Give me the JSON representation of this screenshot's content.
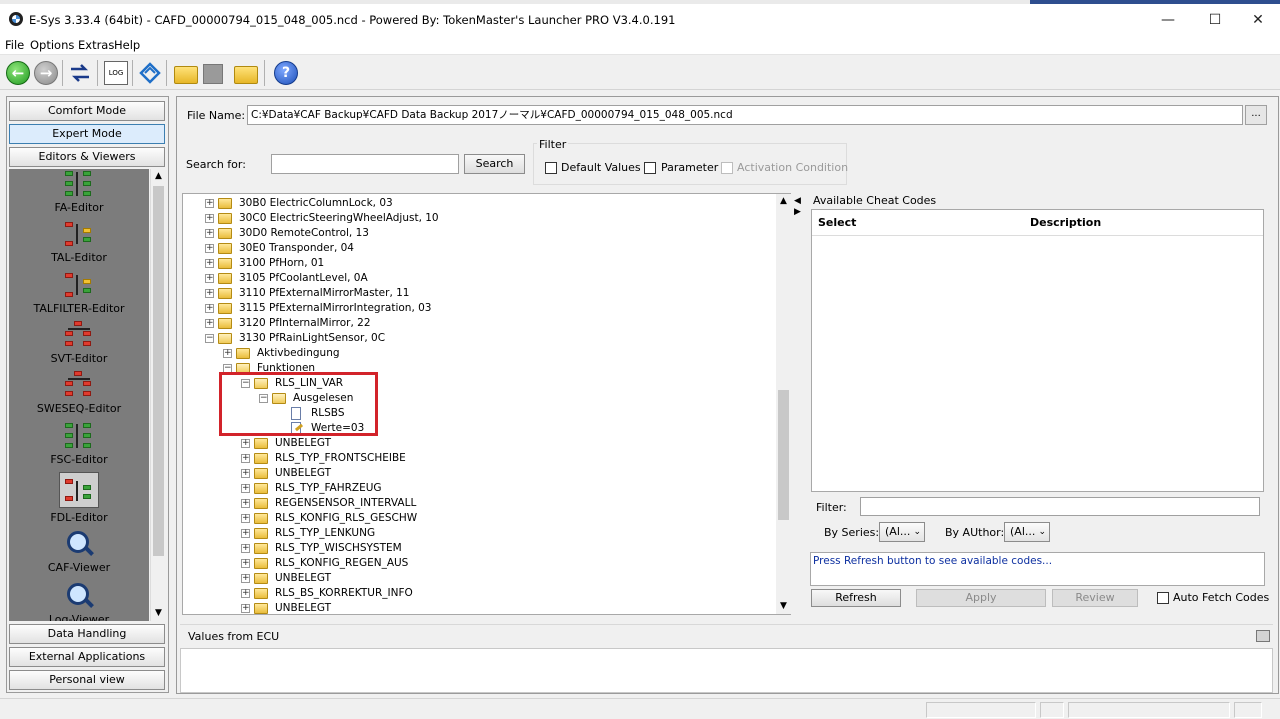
{
  "window": {
    "title": "E-Sys 3.33.4  (64bit) - CAFD_00000794_015_048_005.ncd   - Powered By: TokenMaster's Launcher PRO V3.4.0.191",
    "minimize": "—",
    "maximize": "☐",
    "close": "✕"
  },
  "menu": [
    "File",
    "Options",
    "Extras",
    "Help"
  ],
  "toolbar": {
    "icons": [
      "back-icon",
      "forward-icon",
      "connect-icon",
      "log-icon",
      "bmw-network-icon",
      "open-folder-icon",
      "save-icon",
      "open-folder-icon",
      "help-icon"
    ],
    "log_label": "LOG",
    "back_arrow": "←",
    "forward_arrow": "→",
    "help_glyph": "?"
  },
  "nav": {
    "comfort": "Comfort Mode",
    "expert": "Expert Mode",
    "editors": "Editors & Viewers",
    "data_handling": "Data Handling",
    "external": "External Applications",
    "personal": "Personal view",
    "scroll_up": "▲",
    "scroll_down": "▼",
    "editor_items": [
      "FA-Editor",
      "TAL-Editor",
      "TALFILTER-Editor",
      "SVT-Editor",
      "SWESEQ-Editor",
      "FSC-Editor",
      "FDL-Editor",
      "CAF-Viewer",
      "Log-Viewer"
    ]
  },
  "file": {
    "label": "File Name:",
    "value": "C:¥Data¥CAF Backup¥CAFD Data Backup 2017ノーマル¥CAFD_00000794_015_048_005.ncd",
    "browse": "..."
  },
  "search": {
    "label": "Search for:",
    "value": "",
    "button": "Search"
  },
  "filter": {
    "title": "Filter",
    "default_values": "Default Values",
    "parameter": "Parameter",
    "activation_condition": "Activation Condition"
  },
  "tree": [
    {
      "label": "30B0 ElectricColumnLock, 03",
      "expander": "+"
    },
    {
      "label": "30C0 ElectricSteeringWheelAdjust, 10",
      "expander": "+"
    },
    {
      "label": "30D0 RemoteControl, 13",
      "expander": "+"
    },
    {
      "label": "30E0 Transponder, 04",
      "expander": "+"
    },
    {
      "label": "3100 PfHorn, 01",
      "expander": "+"
    },
    {
      "label": "3105 PfCoolantLevel, 0A",
      "expander": "+"
    },
    {
      "label": "3110 PfExternalMirrorMaster, 11",
      "expander": "+"
    },
    {
      "label": "3115 PfExternalMirrorIntegration, 03",
      "expander": "+"
    },
    {
      "label": "3120 PfInternalMirror, 22",
      "expander": "+"
    },
    {
      "label": "3130 PfRainLightSensor, 0C",
      "expander": "−"
    },
    {
      "label": "Aktivbedingung",
      "expander": "+"
    },
    {
      "label": "Funktionen",
      "expander": "−"
    },
    {
      "label": "RLS_LIN_VAR",
      "expander": "−"
    },
    {
      "label": "Ausgelesen",
      "expander": "−"
    },
    {
      "label": "RLSBS",
      "expander": ""
    },
    {
      "label": "Werte=03",
      "expander": ""
    },
    {
      "label": "UNBELEGT",
      "expander": "+"
    },
    {
      "label": "RLS_TYP_FRONTSCHEIBE",
      "expander": "+"
    },
    {
      "label": "UNBELEGT",
      "expander": "+"
    },
    {
      "label": "RLS_TYP_FAHRZEUG",
      "expander": "+"
    },
    {
      "label": "REGENSENSOR_INTERVALL",
      "expander": "+"
    },
    {
      "label": "RLS_KONFIG_RLS_GESCHW",
      "expander": "+"
    },
    {
      "label": "RLS_TYP_LENKUNG",
      "expander": "+"
    },
    {
      "label": "RLS_TYP_WISCHSYSTEM",
      "expander": "+"
    },
    {
      "label": "RLS_KONFIG_REGEN_AUS",
      "expander": "+"
    },
    {
      "label": "UNBELEGT",
      "expander": "+"
    },
    {
      "label": "RLS_BS_KORREKTUR_INFO",
      "expander": "+"
    },
    {
      "label": "UNBELEGT",
      "expander": "+"
    }
  ],
  "scroll": {
    "up": "▲",
    "down": "▼",
    "split_left": "◀",
    "split_right": "▶"
  },
  "cheat": {
    "title": "Available Cheat Codes",
    "col_select": "Select",
    "col_description": "Description",
    "filter_label": "Filter:",
    "filter_value": "",
    "by_series_label": "By Series:",
    "by_series_value": "(Al...",
    "by_author_label": "By AUthor:",
    "by_author_value": "(Al...",
    "dropdown": "⌄",
    "status": "Press Refresh button to see available codes...",
    "refresh": "Refresh",
    "apply": "Apply",
    "review": "Review",
    "auto_fetch": "Auto Fetch Codes"
  },
  "values": {
    "title": "Values from ECU"
  }
}
